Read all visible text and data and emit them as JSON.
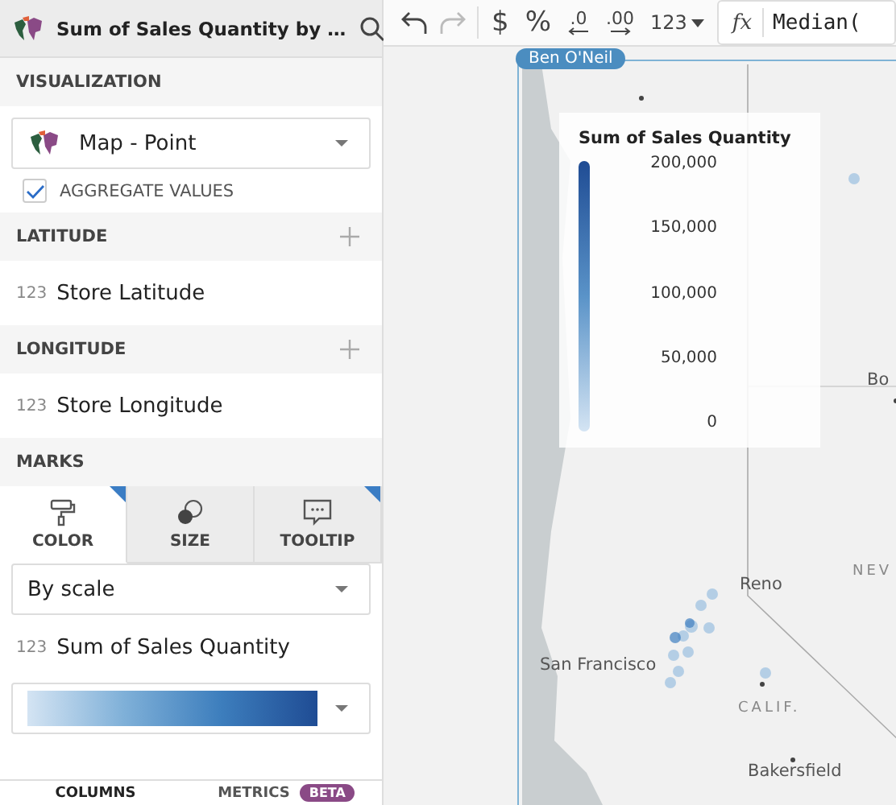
{
  "sidebar": {
    "title": "Sum of Sales Quantity by …",
    "sections": [
      {
        "kind": "viz",
        "heading": "VISUALIZATION",
        "dropdown": "Map - Point",
        "checkbox": {
          "label": "AGGREGATE VALUES",
          "checked": true
        }
      },
      {
        "kind": "field",
        "heading": "LATITUDE",
        "type": "123",
        "field": "Store Latitude"
      },
      {
        "kind": "field",
        "heading": "LONGITUDE",
        "type": "123",
        "field": "Store Longitude"
      },
      {
        "kind": "marks",
        "heading": "MARKS"
      }
    ],
    "mark_tabs": [
      {
        "label": "COLOR",
        "selected": true,
        "flag": true
      },
      {
        "label": "SIZE",
        "selected": false,
        "flag": false
      },
      {
        "label": "TOOLTIP",
        "selected": false,
        "flag": true
      }
    ],
    "color_mode": "By scale",
    "color_field": {
      "type": "123",
      "name": "Sum of Sales Quantity"
    },
    "bottom_tabs": [
      {
        "label": "COLUMNS",
        "selected": true
      },
      {
        "label": "METRICS",
        "selected": false,
        "badge": "BETA"
      }
    ]
  },
  "toolbar": {
    "undo_disabled": false,
    "redo_disabled": true,
    "format_buttons": [
      {
        "kind": "text",
        "label": "$"
      },
      {
        "kind": "text",
        "label": "%"
      },
      {
        "kind": "dec",
        "label": ".0"
      },
      {
        "kind": "inc",
        "label": ".00"
      },
      {
        "kind": "menu",
        "label": "123"
      }
    ],
    "formula_icon": "fx",
    "formula": "Median("
  },
  "map": {
    "user_tag": "Ben O'Neil",
    "legend": {
      "title": "Sum of Sales Quantity",
      "ticks": [
        "200,000",
        "150,000",
        "100,000",
        "50,000",
        "0"
      ]
    },
    "labels": [
      {
        "text": "Bo",
        "kind": "city"
      },
      {
        "text": "NEV",
        "kind": "state"
      },
      {
        "text": "Reno",
        "kind": "city"
      },
      {
        "text": "San Francisco",
        "kind": "city"
      },
      {
        "text": "CALIF.",
        "kind": "state"
      },
      {
        "text": "Bakersfield",
        "kind": "city"
      }
    ]
  }
}
